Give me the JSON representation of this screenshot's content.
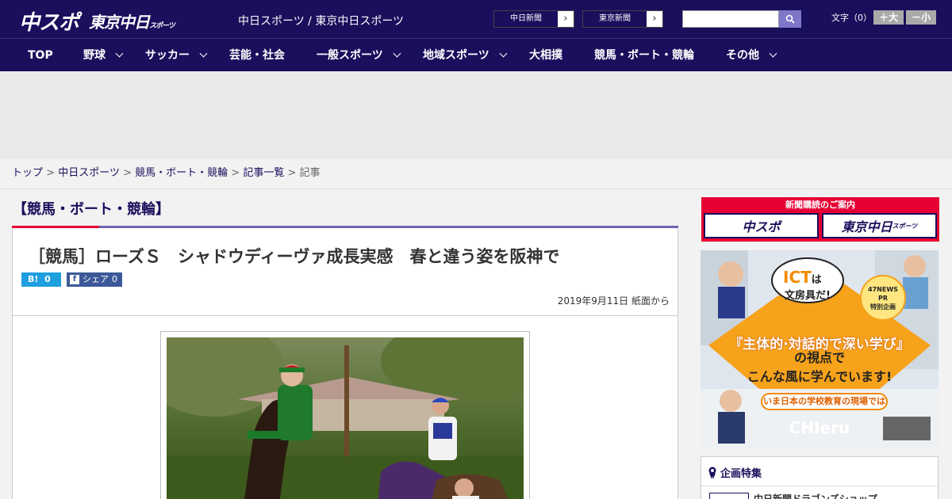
{
  "header": {
    "logo_main": "中スポ",
    "logo_tokyo": "東京中日",
    "logo_tokyo_small": "スポーツ",
    "site_name": "中日スポーツ / 東京中日スポーツ",
    "ext_links": [
      {
        "label": "中日新聞"
      },
      {
        "label": "東京新聞"
      }
    ],
    "search": {
      "placeholder": ""
    },
    "font_size_label": "文字（0）",
    "font_bigger": "＋大",
    "font_smaller": "－小"
  },
  "nav": {
    "items": [
      {
        "label": "TOP",
        "dropdown": false
      },
      {
        "label": "野球",
        "dropdown": true
      },
      {
        "label": "サッカー",
        "dropdown": true
      },
      {
        "label": "芸能・社会",
        "dropdown": false
      },
      {
        "label": "一般スポーツ",
        "dropdown": true
      },
      {
        "label": "地域スポーツ",
        "dropdown": true
      },
      {
        "label": "大相撲",
        "dropdown": false
      },
      {
        "label": "競馬・ボート・競輪",
        "dropdown": false
      },
      {
        "label": "その他",
        "dropdown": true
      }
    ]
  },
  "breadcrumb": {
    "items": [
      "トップ",
      "中日スポーツ",
      "競馬・ボート・競輪",
      "記事一覧"
    ],
    "current": "記事",
    "separator": ">"
  },
  "article": {
    "category": "【競馬・ボート・競輪】",
    "headline": "［競馬］ローズＳ　シャドウディーヴァ成長実感　春と違う姿を阪神で",
    "hatena_count": "0",
    "fb_label": "シェア",
    "fb_count": "0",
    "date": "2019年9月11日 紙面から"
  },
  "sidebar": {
    "subscribe_title": "新聞購読のご案内",
    "subscribe_logos": [
      "中スポ",
      "東京中日"
    ],
    "subscribe_logo_small": "スポーツ",
    "ad": {
      "ict": "ICT",
      "ict_wa": "は",
      "ict_line2": "文房具だ!",
      "badge_l1": "47NEWS",
      "badge_l2": "PR",
      "badge_l3": "特別企画",
      "main": "『主体的·対話的で深い学び』",
      "sub1": "の視点で",
      "sub2": "こんな風に学んでいます!",
      "ribbon": "いま日本の学校教育の現場では",
      "brand": "CHIeru"
    },
    "special_title": "企画特集",
    "special_item": "中日新聞ドラゴンズショップ"
  },
  "colors": {
    "brand_navy": "#1a0f5c",
    "accent_red": "#e60033",
    "accent_purple": "#6c63b5",
    "hatena_blue": "#1e9fdf",
    "facebook_blue": "#3b5998",
    "ad_orange": "#f7a21b"
  }
}
